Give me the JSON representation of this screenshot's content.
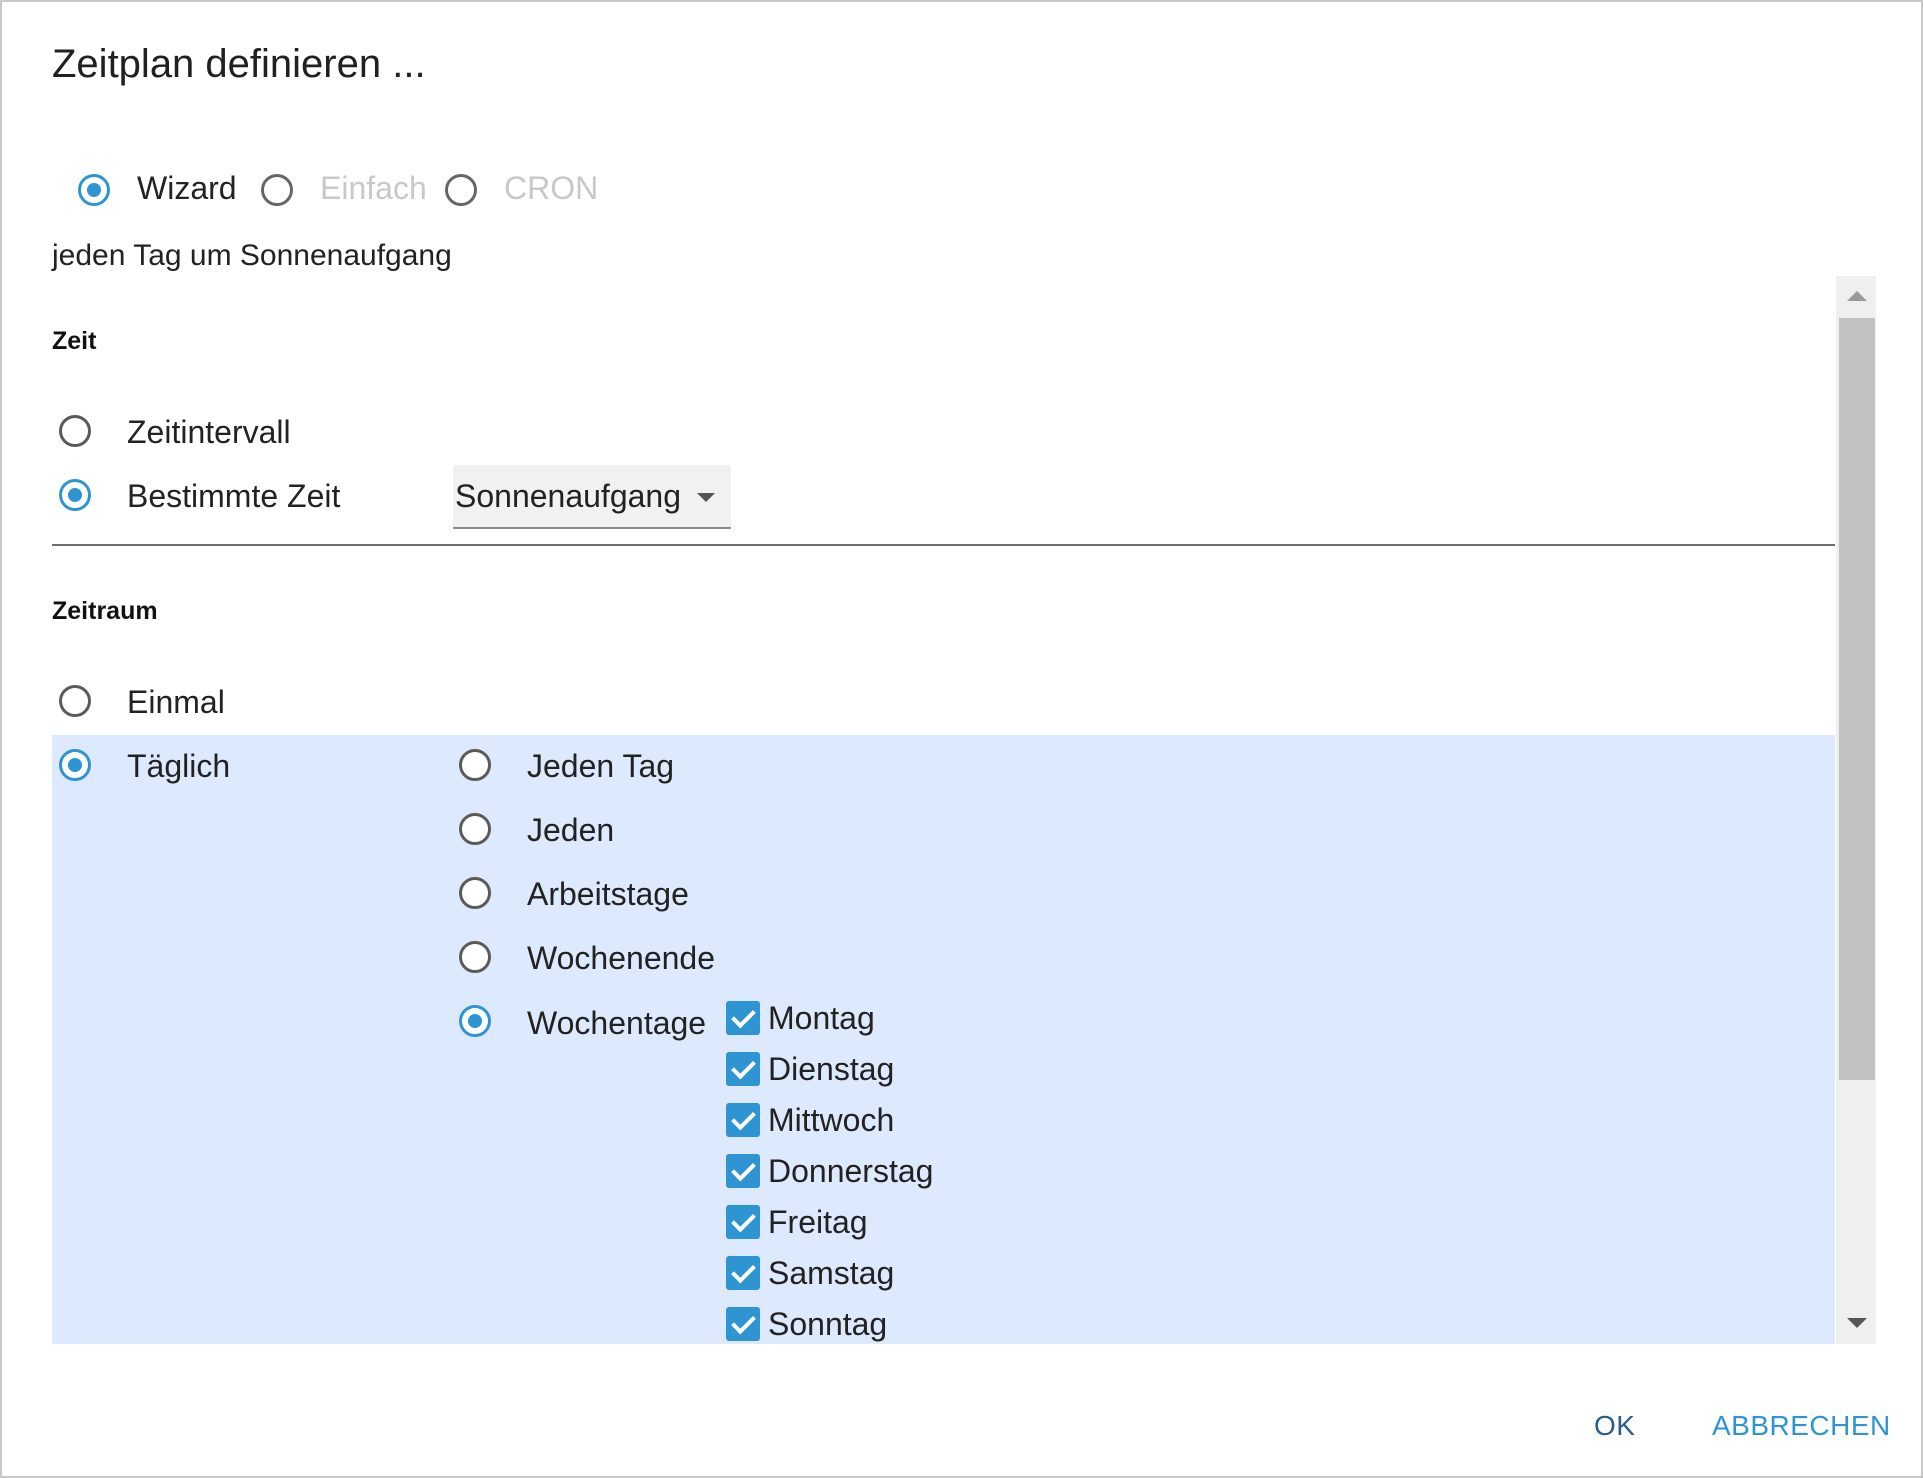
{
  "dialog": {
    "title": "Zeitplan definieren ...",
    "mode_options": [
      {
        "label": "Wizard",
        "selected": true,
        "enabled": true
      },
      {
        "label": "Einfach",
        "selected": false,
        "enabled": false
      },
      {
        "label": "CRON",
        "selected": false,
        "enabled": false
      }
    ],
    "summary": "jeden Tag um Sonnenaufgang",
    "zeit": {
      "heading": "Zeit",
      "options": [
        {
          "label": "Zeitintervall",
          "selected": false
        },
        {
          "label": "Bestimmte Zeit",
          "selected": true
        }
      ],
      "select_value": "Sonnenaufgang"
    },
    "zeitraum": {
      "heading": "Zeitraum",
      "options": [
        {
          "label": "Einmal",
          "selected": false
        },
        {
          "label": "Täglich",
          "selected": true
        }
      ],
      "daily_options": [
        {
          "label": "Jeden Tag",
          "selected": false
        },
        {
          "label": "Jeden",
          "selected": false
        },
        {
          "label": "Arbeitstage",
          "selected": false
        },
        {
          "label": "Wochenende",
          "selected": false
        },
        {
          "label": "Wochentage",
          "selected": true
        }
      ],
      "weekdays": [
        {
          "label": "Montag",
          "checked": true
        },
        {
          "label": "Dienstag",
          "checked": true
        },
        {
          "label": "Mittwoch",
          "checked": true
        },
        {
          "label": "Donnerstag",
          "checked": true
        },
        {
          "label": "Freitag",
          "checked": true
        },
        {
          "label": "Samstag",
          "checked": true
        },
        {
          "label": "Sonntag",
          "checked": true
        }
      ]
    },
    "buttons": {
      "ok": "OK",
      "cancel": "ABBRECHEN"
    }
  },
  "colors": {
    "accent": "#2f95d2",
    "highlight": "#dde9fc"
  }
}
